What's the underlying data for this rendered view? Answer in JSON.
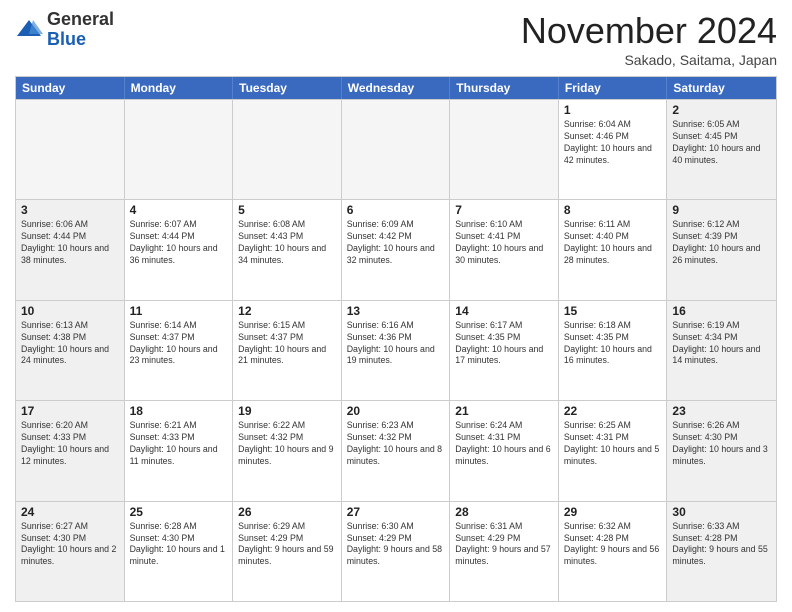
{
  "logo": {
    "general": "General",
    "blue": "Blue"
  },
  "header": {
    "month": "November 2024",
    "location": "Sakado, Saitama, Japan"
  },
  "weekdays": [
    "Sunday",
    "Monday",
    "Tuesday",
    "Wednesday",
    "Thursday",
    "Friday",
    "Saturday"
  ],
  "rows": [
    [
      {
        "day": "",
        "info": "",
        "empty": true
      },
      {
        "day": "",
        "info": "",
        "empty": true
      },
      {
        "day": "",
        "info": "",
        "empty": true
      },
      {
        "day": "",
        "info": "",
        "empty": true
      },
      {
        "day": "",
        "info": "",
        "empty": true
      },
      {
        "day": "1",
        "info": "Sunrise: 6:04 AM\nSunset: 4:46 PM\nDaylight: 10 hours and 42 minutes."
      },
      {
        "day": "2",
        "info": "Sunrise: 6:05 AM\nSunset: 4:45 PM\nDaylight: 10 hours and 40 minutes.",
        "shaded": true
      }
    ],
    [
      {
        "day": "3",
        "info": "Sunrise: 6:06 AM\nSunset: 4:44 PM\nDaylight: 10 hours and 38 minutes.",
        "shaded": true
      },
      {
        "day": "4",
        "info": "Sunrise: 6:07 AM\nSunset: 4:44 PM\nDaylight: 10 hours and 36 minutes."
      },
      {
        "day": "5",
        "info": "Sunrise: 6:08 AM\nSunset: 4:43 PM\nDaylight: 10 hours and 34 minutes."
      },
      {
        "day": "6",
        "info": "Sunrise: 6:09 AM\nSunset: 4:42 PM\nDaylight: 10 hours and 32 minutes."
      },
      {
        "day": "7",
        "info": "Sunrise: 6:10 AM\nSunset: 4:41 PM\nDaylight: 10 hours and 30 minutes."
      },
      {
        "day": "8",
        "info": "Sunrise: 6:11 AM\nSunset: 4:40 PM\nDaylight: 10 hours and 28 minutes."
      },
      {
        "day": "9",
        "info": "Sunrise: 6:12 AM\nSunset: 4:39 PM\nDaylight: 10 hours and 26 minutes.",
        "shaded": true
      }
    ],
    [
      {
        "day": "10",
        "info": "Sunrise: 6:13 AM\nSunset: 4:38 PM\nDaylight: 10 hours and 24 minutes.",
        "shaded": true
      },
      {
        "day": "11",
        "info": "Sunrise: 6:14 AM\nSunset: 4:37 PM\nDaylight: 10 hours and 23 minutes."
      },
      {
        "day": "12",
        "info": "Sunrise: 6:15 AM\nSunset: 4:37 PM\nDaylight: 10 hours and 21 minutes."
      },
      {
        "day": "13",
        "info": "Sunrise: 6:16 AM\nSunset: 4:36 PM\nDaylight: 10 hours and 19 minutes."
      },
      {
        "day": "14",
        "info": "Sunrise: 6:17 AM\nSunset: 4:35 PM\nDaylight: 10 hours and 17 minutes."
      },
      {
        "day": "15",
        "info": "Sunrise: 6:18 AM\nSunset: 4:35 PM\nDaylight: 10 hours and 16 minutes."
      },
      {
        "day": "16",
        "info": "Sunrise: 6:19 AM\nSunset: 4:34 PM\nDaylight: 10 hours and 14 minutes.",
        "shaded": true
      }
    ],
    [
      {
        "day": "17",
        "info": "Sunrise: 6:20 AM\nSunset: 4:33 PM\nDaylight: 10 hours and 12 minutes.",
        "shaded": true
      },
      {
        "day": "18",
        "info": "Sunrise: 6:21 AM\nSunset: 4:33 PM\nDaylight: 10 hours and 11 minutes."
      },
      {
        "day": "19",
        "info": "Sunrise: 6:22 AM\nSunset: 4:32 PM\nDaylight: 10 hours and 9 minutes."
      },
      {
        "day": "20",
        "info": "Sunrise: 6:23 AM\nSunset: 4:32 PM\nDaylight: 10 hours and 8 minutes."
      },
      {
        "day": "21",
        "info": "Sunrise: 6:24 AM\nSunset: 4:31 PM\nDaylight: 10 hours and 6 minutes."
      },
      {
        "day": "22",
        "info": "Sunrise: 6:25 AM\nSunset: 4:31 PM\nDaylight: 10 hours and 5 minutes."
      },
      {
        "day": "23",
        "info": "Sunrise: 6:26 AM\nSunset: 4:30 PM\nDaylight: 10 hours and 3 minutes.",
        "shaded": true
      }
    ],
    [
      {
        "day": "24",
        "info": "Sunrise: 6:27 AM\nSunset: 4:30 PM\nDaylight: 10 hours and 2 minutes.",
        "shaded": true
      },
      {
        "day": "25",
        "info": "Sunrise: 6:28 AM\nSunset: 4:30 PM\nDaylight: 10 hours and 1 minute."
      },
      {
        "day": "26",
        "info": "Sunrise: 6:29 AM\nSunset: 4:29 PM\nDaylight: 9 hours and 59 minutes."
      },
      {
        "day": "27",
        "info": "Sunrise: 6:30 AM\nSunset: 4:29 PM\nDaylight: 9 hours and 58 minutes."
      },
      {
        "day": "28",
        "info": "Sunrise: 6:31 AM\nSunset: 4:29 PM\nDaylight: 9 hours and 57 minutes."
      },
      {
        "day": "29",
        "info": "Sunrise: 6:32 AM\nSunset: 4:28 PM\nDaylight: 9 hours and 56 minutes."
      },
      {
        "day": "30",
        "info": "Sunrise: 6:33 AM\nSunset: 4:28 PM\nDaylight: 9 hours and 55 minutes.",
        "shaded": true
      }
    ]
  ]
}
